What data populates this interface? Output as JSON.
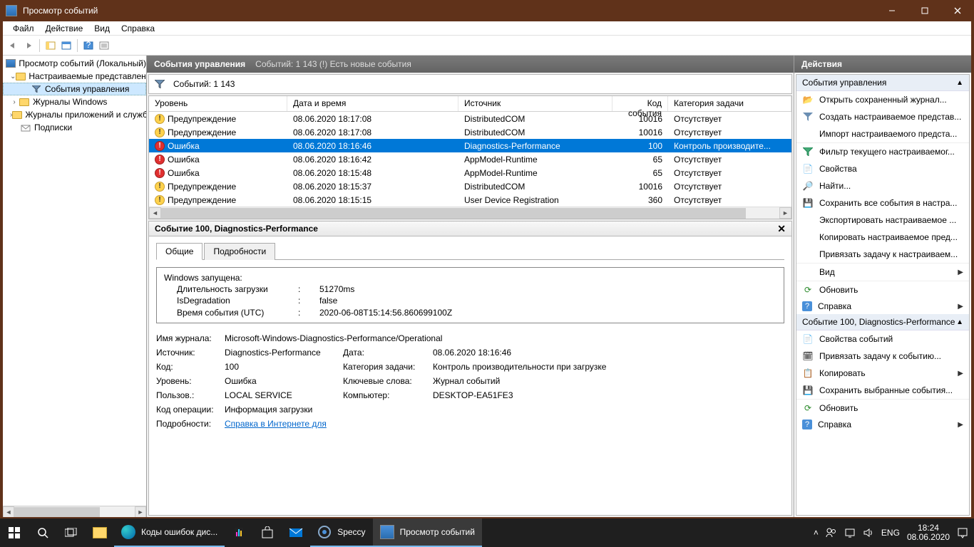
{
  "window": {
    "title": "Просмотр событий"
  },
  "menu": {
    "file": "Файл",
    "action": "Действие",
    "view": "Вид",
    "help": "Справка"
  },
  "tree": {
    "root": "Просмотр событий (Локальный)",
    "n1": "Настраиваемые представления",
    "n1a": "События управления",
    "n2": "Журналы Windows",
    "n3": "Журналы приложений и служб",
    "n4": "Подписки"
  },
  "center": {
    "title": "События управления",
    "subtitle": "Событий: 1 143 (!) Есть новые события",
    "filter": "Событий: 1 143",
    "cols": {
      "level": "Уровень",
      "date": "Дата и время",
      "source": "Источник",
      "code": "Код события",
      "cat": "Категория задачи"
    },
    "rows": [
      {
        "lvl": "warn",
        "level": "Предупреждение",
        "date": "08.06.2020 18:17:08",
        "source": "DistributedCOM",
        "code": "10016",
        "cat": "Отсутствует"
      },
      {
        "lvl": "warn",
        "level": "Предупреждение",
        "date": "08.06.2020 18:17:08",
        "source": "DistributedCOM",
        "code": "10016",
        "cat": "Отсутствует"
      },
      {
        "lvl": "err",
        "level": "Ошибка",
        "date": "08.06.2020 18:16:46",
        "source": "Diagnostics-Performance",
        "code": "100",
        "cat": "Контроль производите...",
        "selected": true
      },
      {
        "lvl": "err",
        "level": "Ошибка",
        "date": "08.06.2020 18:16:42",
        "source": "AppModel-Runtime",
        "code": "65",
        "cat": "Отсутствует"
      },
      {
        "lvl": "err",
        "level": "Ошибка",
        "date": "08.06.2020 18:15:48",
        "source": "AppModel-Runtime",
        "code": "65",
        "cat": "Отсутствует"
      },
      {
        "lvl": "warn",
        "level": "Предупреждение",
        "date": "08.06.2020 18:15:37",
        "source": "DistributedCOM",
        "code": "10016",
        "cat": "Отсутствует"
      },
      {
        "lvl": "warn",
        "level": "Предупреждение",
        "date": "08.06.2020 18:15:15",
        "source": "User Device Registration",
        "code": "360",
        "cat": "Отсутствует"
      }
    ]
  },
  "detail": {
    "title": "Событие 100, Diagnostics-Performance",
    "tab_general": "Общие",
    "tab_details": "Подробности",
    "msg": {
      "l1": "Windows запущена:",
      "k1": "Длительность загрузки",
      "v1": "51270ms",
      "k2": "IsDegradation",
      "v2": "false",
      "k3": "Время события (UTC)",
      "v3": "2020-06-08T15:14:56.860699100Z"
    },
    "props": {
      "log_l": "Имя журнала:",
      "log_v": "Microsoft-Windows-Diagnostics-Performance/Operational",
      "src_l": "Источник:",
      "src_v": "Diagnostics-Performance",
      "date_l": "Дата:",
      "date_v": "08.06.2020 18:16:46",
      "code_l": "Код:",
      "code_v": "100",
      "cat_l": "Категория задачи:",
      "cat_v": "Контроль производительности при загрузке",
      "lvl_l": "Уровень:",
      "lvl_v": "Ошибка",
      "kw_l": "Ключевые слова:",
      "kw_v": "Журнал событий",
      "usr_l": "Пользов.:",
      "usr_v": "LOCAL SERVICE",
      "pc_l": "Компьютер:",
      "pc_v": "DESKTOP-EA51FE3",
      "op_l": "Код операции:",
      "op_v": "Информация загрузки",
      "more_l": "Подробности:",
      "more_v": "Справка в Интернете для "
    }
  },
  "actions": {
    "title": "Действия",
    "sec1": "События управления",
    "a1": "Открыть сохраненный журнал...",
    "a2": "Создать настраиваемое представ...",
    "a3": "Импорт настраиваемого предста...",
    "a4": "Фильтр текущего настраиваемог...",
    "a5": "Свойства",
    "a6": "Найти...",
    "a7": "Сохранить все события в настра...",
    "a8": "Экспортировать настраиваемое ...",
    "a9": "Копировать настраиваемое пред...",
    "a10": "Привязать задачу к настраиваем...",
    "a11": "Вид",
    "a12": "Обновить",
    "a13": "Справка",
    "sec2": "Событие 100, Diagnostics-Performance",
    "b1": "Свойства событий",
    "b2": "Привязать задачу к событию...",
    "b3": "Копировать",
    "b4": "Сохранить выбранные события...",
    "b5": "Обновить",
    "b6": "Справка"
  },
  "taskbar": {
    "app1": "Коды ошибок дис...",
    "app2": "Speccy",
    "app3": "Просмотр событий",
    "lang": "ENG",
    "time": "18:24",
    "date": "08.06.2020"
  }
}
